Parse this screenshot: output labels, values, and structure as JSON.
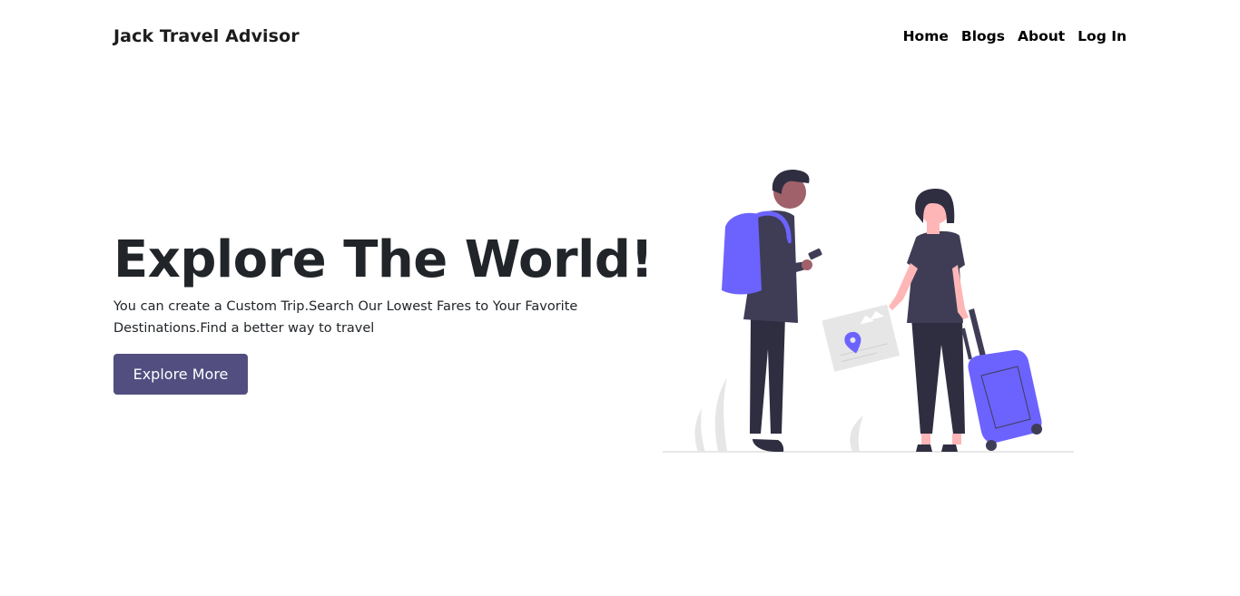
{
  "header": {
    "brand": "Jack Travel Advisor",
    "nav": [
      "Home",
      "Blogs",
      "About",
      "Log In"
    ]
  },
  "hero": {
    "title": "Explore The World!",
    "description": "You can create a Custom Trip.Search Our Lowest Fares to Your Favorite Destinations.Find a better way to travel",
    "button_label": "Explore More"
  },
  "illustration": {
    "subject": "travelers-illustration",
    "colors": {
      "accent": "#6c63ff",
      "dark": "#3f3d56",
      "skin_dark": "#a0616a",
      "skin_light": "#ffb6b6",
      "ground": "#e6e6e6"
    }
  },
  "colors": {
    "button": "#524e80",
    "text": "#212529"
  }
}
